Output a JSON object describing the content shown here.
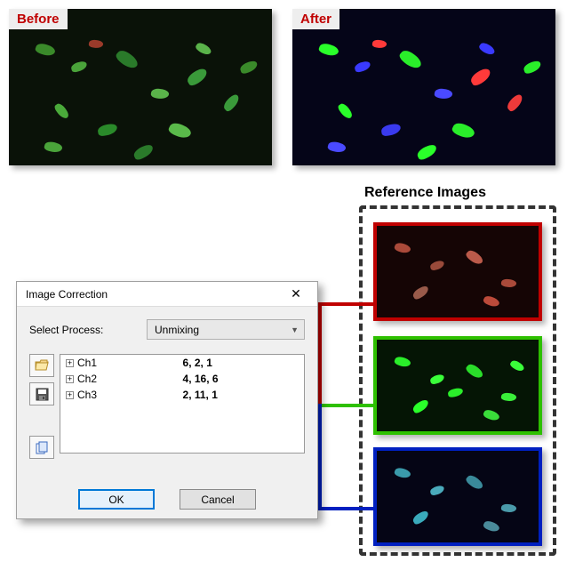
{
  "images": {
    "before_label": "Before",
    "after_label": "After"
  },
  "reference": {
    "title": "Reference Images"
  },
  "dialog": {
    "title": "Image Correction",
    "select_label": "Select Process:",
    "process": "Unmixing",
    "channels": [
      {
        "name": "Ch1",
        "values": "6, 2, 1"
      },
      {
        "name": "Ch2",
        "values": "4, 16, 6"
      },
      {
        "name": "Ch3",
        "values": "2, 11, 1"
      }
    ],
    "ok": "OK",
    "cancel": "Cancel"
  },
  "icons": {
    "open": "folder-open-icon",
    "save": "save-icon",
    "copy": "copy-icon",
    "close": "close-icon",
    "chevron": "chevron-down-icon"
  }
}
